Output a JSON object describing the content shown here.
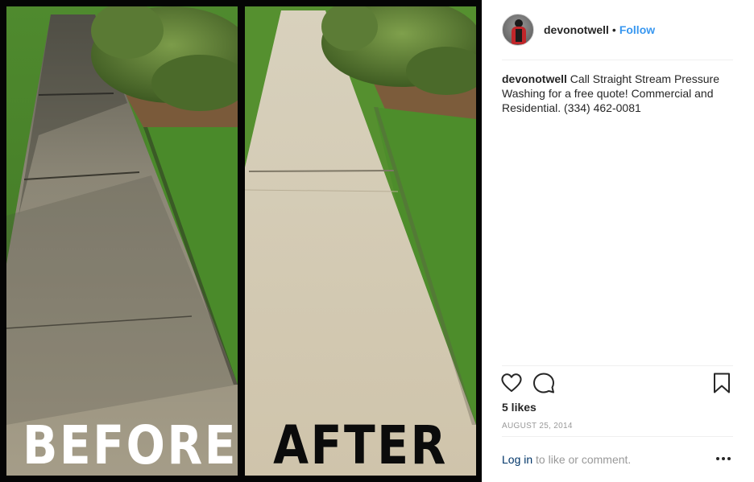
{
  "media": {
    "before_label": "BEFORE",
    "after_label": "AFTER"
  },
  "post": {
    "username": "devonotwell",
    "separator": "•",
    "follow_label": "Follow",
    "caption_user": "devonotwell",
    "caption_text": "Call Straight Stream Pressure Washing for a free quote! Commercial and Residential. (334) 462-0081",
    "likes": "5 likes",
    "date": "AUGUST 25, 2014"
  },
  "footer": {
    "login_link": "Log in",
    "login_suffix": " to like or comment."
  },
  "icons": {
    "like": "heart-icon",
    "comment": "comment-icon",
    "save": "bookmark-icon",
    "more": "more-options-icon"
  },
  "colors": {
    "follow": "#3897f0",
    "link": "#003569",
    "muted": "#999999",
    "text": "#262626"
  }
}
